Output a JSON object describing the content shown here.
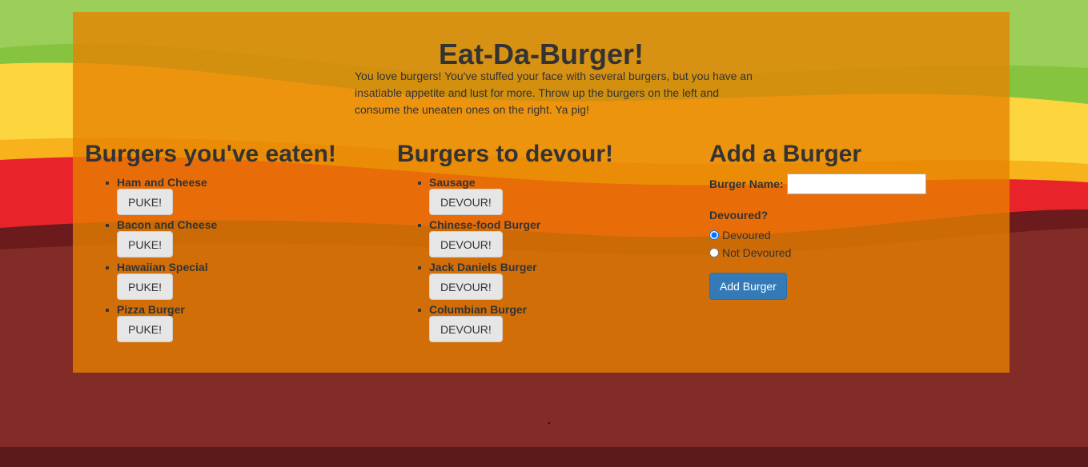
{
  "colors": {
    "green": "#9cce5a",
    "yellow": "#fdd53f",
    "red": "#e8242a",
    "maroon": "#832b26",
    "panel": "#e88100",
    "primary_button": "#337ab7"
  },
  "header": {
    "title": "Eat-Da-Burger!",
    "intro": "You love burgers! You've stuffed your face with several burgers, but you have an insatiable appetite and lust for more. Throw up the burgers on the left and consume the uneaten ones on the right. Ya pig!"
  },
  "eaten": {
    "heading": "Burgers you've eaten!",
    "button_label": "PUKE!",
    "items": [
      {
        "name": "Ham and Cheese"
      },
      {
        "name": "Bacon and Cheese"
      },
      {
        "name": "Hawaiian Special"
      },
      {
        "name": "Pizza Burger"
      }
    ]
  },
  "to_devour": {
    "heading": "Burgers to devour!",
    "button_label": "DEVOUR!",
    "items": [
      {
        "name": "Sausage"
      },
      {
        "name": "Chinese-food Burger"
      },
      {
        "name": "Jack Daniels Burger"
      },
      {
        "name": "Columbian Burger"
      }
    ]
  },
  "add_form": {
    "heading": "Add a Burger",
    "name_label": "Burger Name:",
    "name_value": "",
    "devoured_label": "Devoured?",
    "options": [
      {
        "label": "Devoured",
        "checked": true
      },
      {
        "label": "Not Devoured",
        "checked": false
      }
    ],
    "submit_label": "Add Burger"
  }
}
